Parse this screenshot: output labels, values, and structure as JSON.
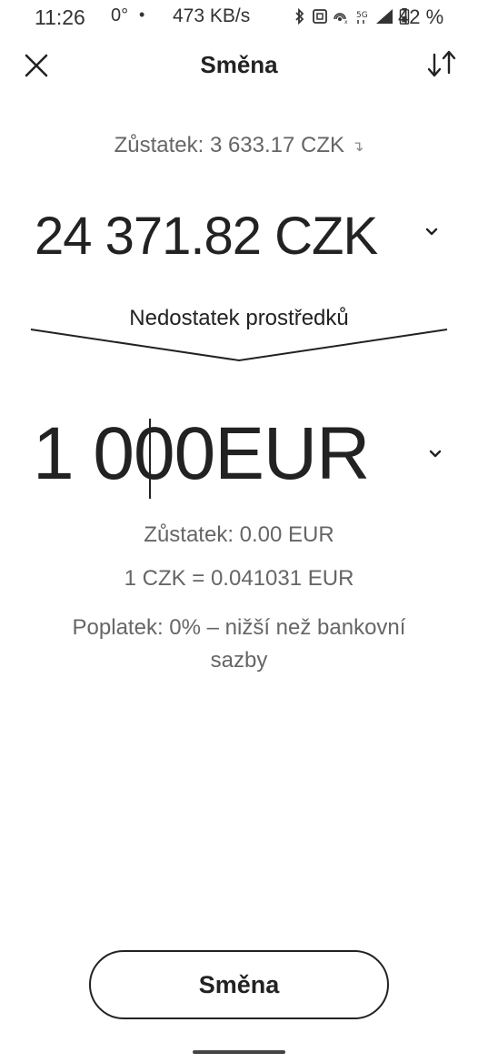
{
  "status_bar": {
    "time": "11:26",
    "temperature": "0°",
    "dot": "•",
    "speed": "473 KB/s",
    "battery": "42 %",
    "icons": [
      "bluetooth-icon",
      "nfc-icon",
      "hotspot-icon",
      "5g-icon",
      "signal-icon",
      "battery-icon"
    ]
  },
  "header": {
    "title": "Směna",
    "close_icon": "close-icon",
    "swap_icon": "swap-arrows-icon"
  },
  "from": {
    "balance": "Zůstatek: 3 633.17 CZK",
    "amount": "24 371.82 CZK"
  },
  "notice": {
    "label": "Nedostatek prostředků"
  },
  "to": {
    "amount": "1 000EUR",
    "balance": "Zůstatek: 0.00 EUR"
  },
  "rate": "1 CZK = 0.041031 EUR",
  "fee": "Poplatek: 0% – nižší než bankovní sazby",
  "actions": {
    "exchange_label": "Směna"
  },
  "colors": {
    "text": "#222222",
    "muted": "#666666",
    "background": "#ffffff"
  }
}
